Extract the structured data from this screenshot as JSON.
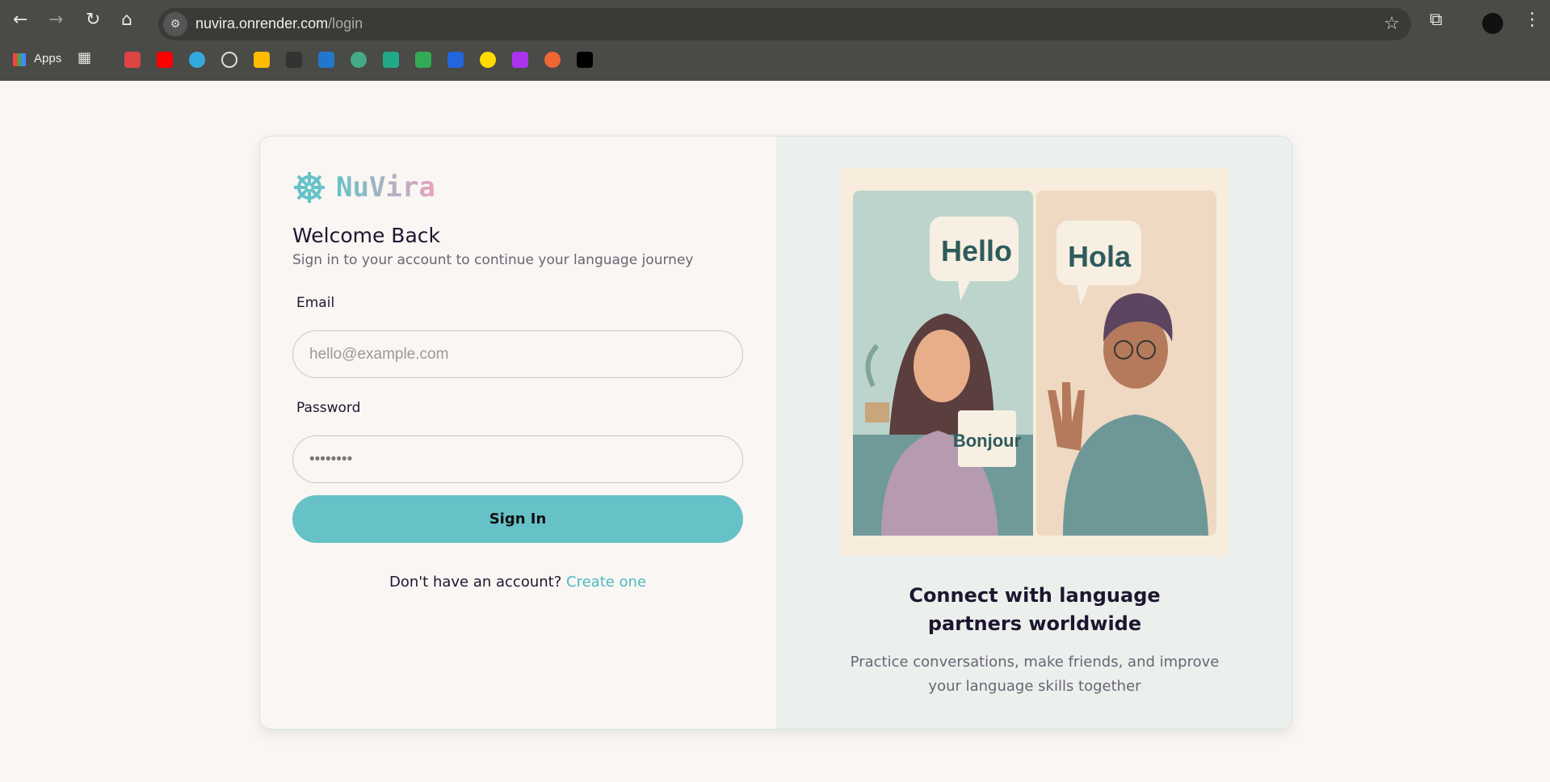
{
  "browser": {
    "url_host": "nuvira.onrender.com",
    "url_path": "/login",
    "bookmarks_apps_label": "Apps"
  },
  "brand": {
    "name": "NuVira"
  },
  "login": {
    "title": "Welcome Back",
    "subtitle": "Sign in to your account to continue your language journey",
    "email_label": "Email",
    "email_placeholder": "hello@example.com",
    "password_label": "Password",
    "password_value": "••••••••",
    "submit_label": "Sign In",
    "signup_prompt": "Don't have an account?",
    "signup_link": "Create one"
  },
  "promo": {
    "heading": "Connect with language partners worldwide",
    "text": "Practice conversations, make friends, and improve your language skills together",
    "bubble_left": "Hello",
    "bubble_right": "Hola",
    "card_text": "Bonjour"
  },
  "colors": {
    "accent": "#66c2c7",
    "bg": "#f9f6f3"
  }
}
